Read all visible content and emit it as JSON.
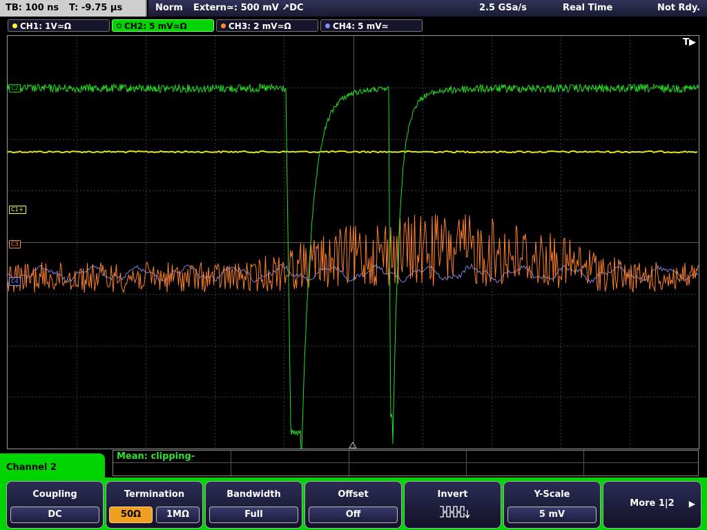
{
  "topbar": {
    "timebase": "TB: 100 ns",
    "trigger_time": "T: -9.75 µs",
    "mode": "Norm",
    "trigger_source": "Extern≃: 500 mV ↗DC",
    "sample_rate": "2.5 GSa/s",
    "acq_mode": "Real Time",
    "status": "Not Rdy."
  },
  "channels": [
    {
      "label": "CH1: 1V≃Ω",
      "color": "#ffff30"
    },
    {
      "label": "CH2: 5 mV≃Ω",
      "color": "#00d400"
    },
    {
      "label": "CH3: 2 mV≃Ω",
      "color": "#ff8c30"
    },
    {
      "label": "CH4: 5 mV≃",
      "color": "#8888ff"
    }
  ],
  "plot": {
    "trigger_marker": "T▶",
    "ref_labels": {
      "c2": "C2",
      "c1": "C1⏚",
      "c3": "C3",
      "c4": "C4"
    }
  },
  "measurement": {
    "text": "Mean: clipping-"
  },
  "menu": {
    "title": "Channel 2"
  },
  "softkeys": {
    "coupling": {
      "title": "Coupling",
      "value": "DC"
    },
    "termination": {
      "title": "Termination",
      "opt1": "50Ω",
      "opt2": "1MΩ"
    },
    "bandwidth": {
      "title": "Bandwidth",
      "value": "Full"
    },
    "offset": {
      "title": "Offset",
      "value": "Off"
    },
    "invert": {
      "title": "Invert",
      "icon": "pulse-invert-icon"
    },
    "yscale": {
      "title": "Y-Scale",
      "value": "5 mV"
    },
    "more": {
      "label": "More 1|2"
    }
  },
  "colors": {
    "ch1": "#ffff30",
    "ch2": "#00d400",
    "ch3": "#ff8c30",
    "ch4": "#8888ff",
    "accent": "#f0a020"
  }
}
